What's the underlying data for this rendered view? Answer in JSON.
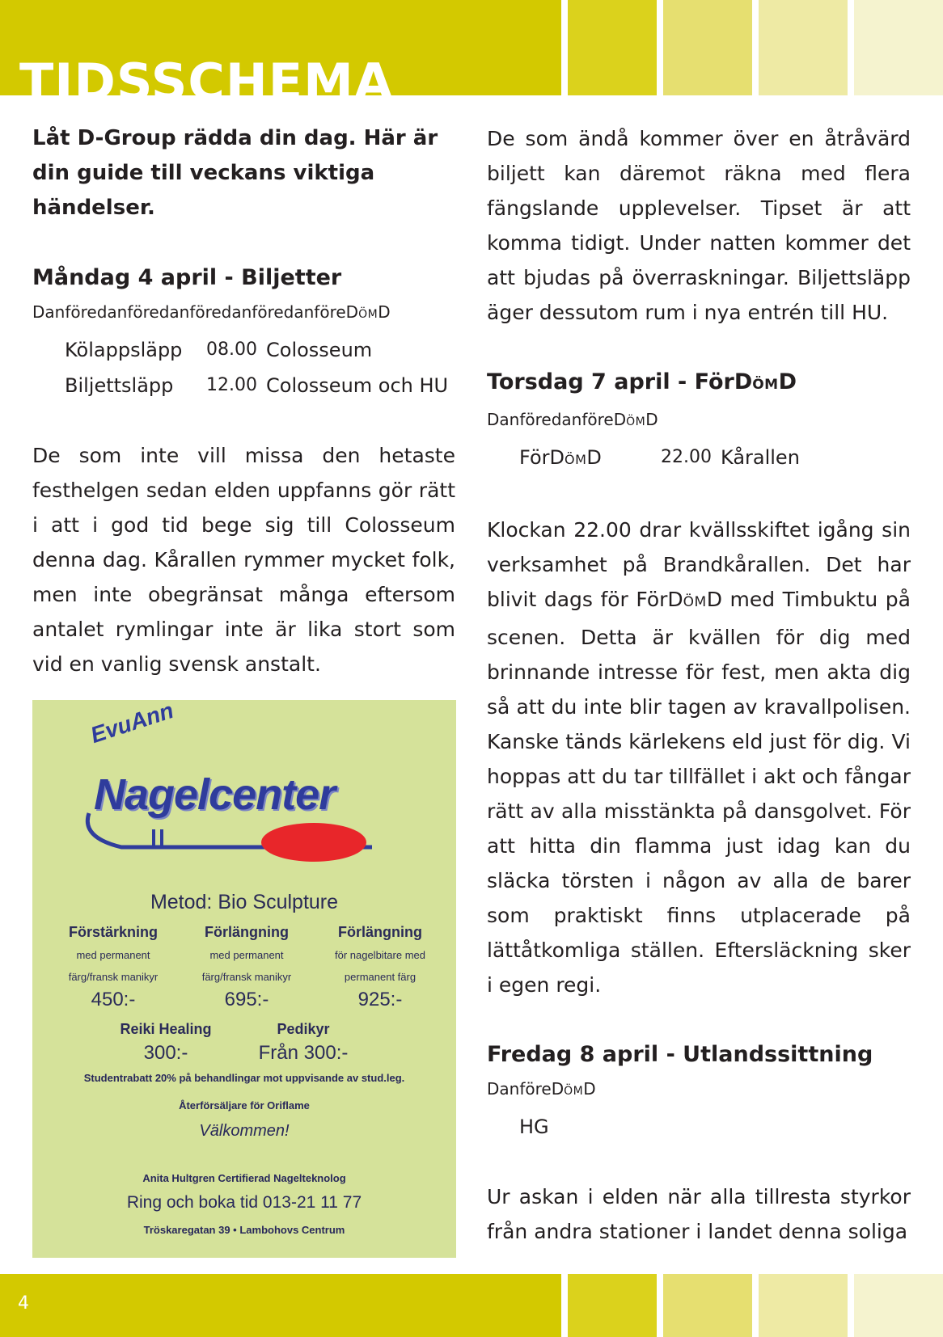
{
  "header": {
    "title": "TIDSSCHEMA"
  },
  "left": {
    "lead": "Låt D-Group rädda din dag. Här är din guide till veckans viktiga händelser.",
    "monday": {
      "heading": "Måndag 4 april - Biljetter",
      "dresscode_main": "DanföredanföredanföredanföredanföreD",
      "dresscode_sc": "ÖM",
      "dresscode_end": "D",
      "events": [
        {
          "name": "Kölappsläpp",
          "time": "08.00",
          "place": "Colosseum"
        },
        {
          "name": "Biljettsläpp",
          "time": "12.00",
          "place": "Colosseum och HU"
        }
      ]
    },
    "para": "De som inte vill missa den hetaste festhelgen sedan elden uppfanns gör rätt i att i god tid bege sig till Colosseum denna dag. Kårallen rymmer mycket folk, men inte obegränsat många eftersom antalet rymlingar inte är lika stort som vid en vanlig svensk anstalt."
  },
  "ad": {
    "script": "EvuAnn",
    "logo": "Nagelcenter",
    "method": "Metod: Bio Sculpture",
    "services": [
      {
        "name": "Förstärkning",
        "line1": "med permanent",
        "line2": "färg/fransk manikyr",
        "price": "450:-"
      },
      {
        "name": "Förlängning",
        "line1": "med permanent",
        "line2": "färg/fransk manikyr",
        "price": "695:-"
      },
      {
        "name": "Förlängning",
        "line1": "för nagelbitare med",
        "line2": "permanent färg",
        "price": "925:-"
      }
    ],
    "extras": [
      {
        "name": "Reiki Healing",
        "price": "300:-"
      },
      {
        "name": "Pedikyr",
        "price": "Från 300:-"
      }
    ],
    "rebate": "Studentrabatt 20% på behandlingar mot uppvisande av stud.leg.",
    "agent": "Återförsäljare för Oriflame",
    "welcome": "Välkommen!",
    "person": "Anita Hultgren Certifierad Nagelteknolog",
    "phone": "Ring och boka tid 013-21 11 77",
    "address": "Tröskaregatan 39 • Lambohovs Centrum",
    "colors": {
      "background": "#d5e29a",
      "logo": "#2f3c9c",
      "accent": "#e8262a"
    }
  },
  "right": {
    "para1": "De som ändå kommer över en åtråvärd biljett kan däremot räkna med flera fängslande upplevelser. Tipset är att komma tidigt. Under natten kommer det att bjudas på överraskningar. Biljettsläpp äger dessutom rum i nya entrén till HU.",
    "thursday": {
      "heading_main": "Torsdag 7 april - FörD",
      "heading_sc": "ÖM",
      "heading_end": "D",
      "dresscode_main": "DanföredanföreD",
      "dresscode_sc": "ÖM",
      "dresscode_end": "D",
      "event_name_main": "FörD",
      "event_name_sc": "ÖM",
      "event_name_end": "D",
      "event_time": "22.00",
      "event_place": "Kårallen"
    },
    "para2_a": "Klockan 22.00 drar kvällsskiftet igång sin verksamhet på Brandkårallen. Det har blivit dags för FörD",
    "para2_sc": "ÖM",
    "para2_b": "D med Timbuktu på scenen. Detta är kvällen för dig med brinnande intresse för fest, men akta dig så att du inte blir tagen av kravallpolisen. Kanske tänds kärlekens eld just för dig. Vi hoppas att du tar tillfället i akt och fångar rätt av alla misstänkta på dansgolvet. För att hitta din flamma just idag kan du släcka törsten i någon av alla de barer som praktiskt finns utplacerade på lättåtkomliga ställen. Eftersläckning sker i egen regi.",
    "friday": {
      "heading": "Fredag 8 april - Utlandssittning",
      "dresscode_main": "DanföreD",
      "dresscode_sc": "ÖM",
      "dresscode_end": "D",
      "event_place": "HG"
    },
    "para3": "Ur askan i elden när alla tillresta styrkor från andra stationer i landet denna soliga"
  },
  "footer": {
    "page_number": "4"
  },
  "colors": {
    "band": "#d3c900",
    "band_tints": [
      "#dbd21c",
      "#e6df70",
      "#eeeaa4",
      "#f5f3cf"
    ],
    "text": "#231f20"
  }
}
